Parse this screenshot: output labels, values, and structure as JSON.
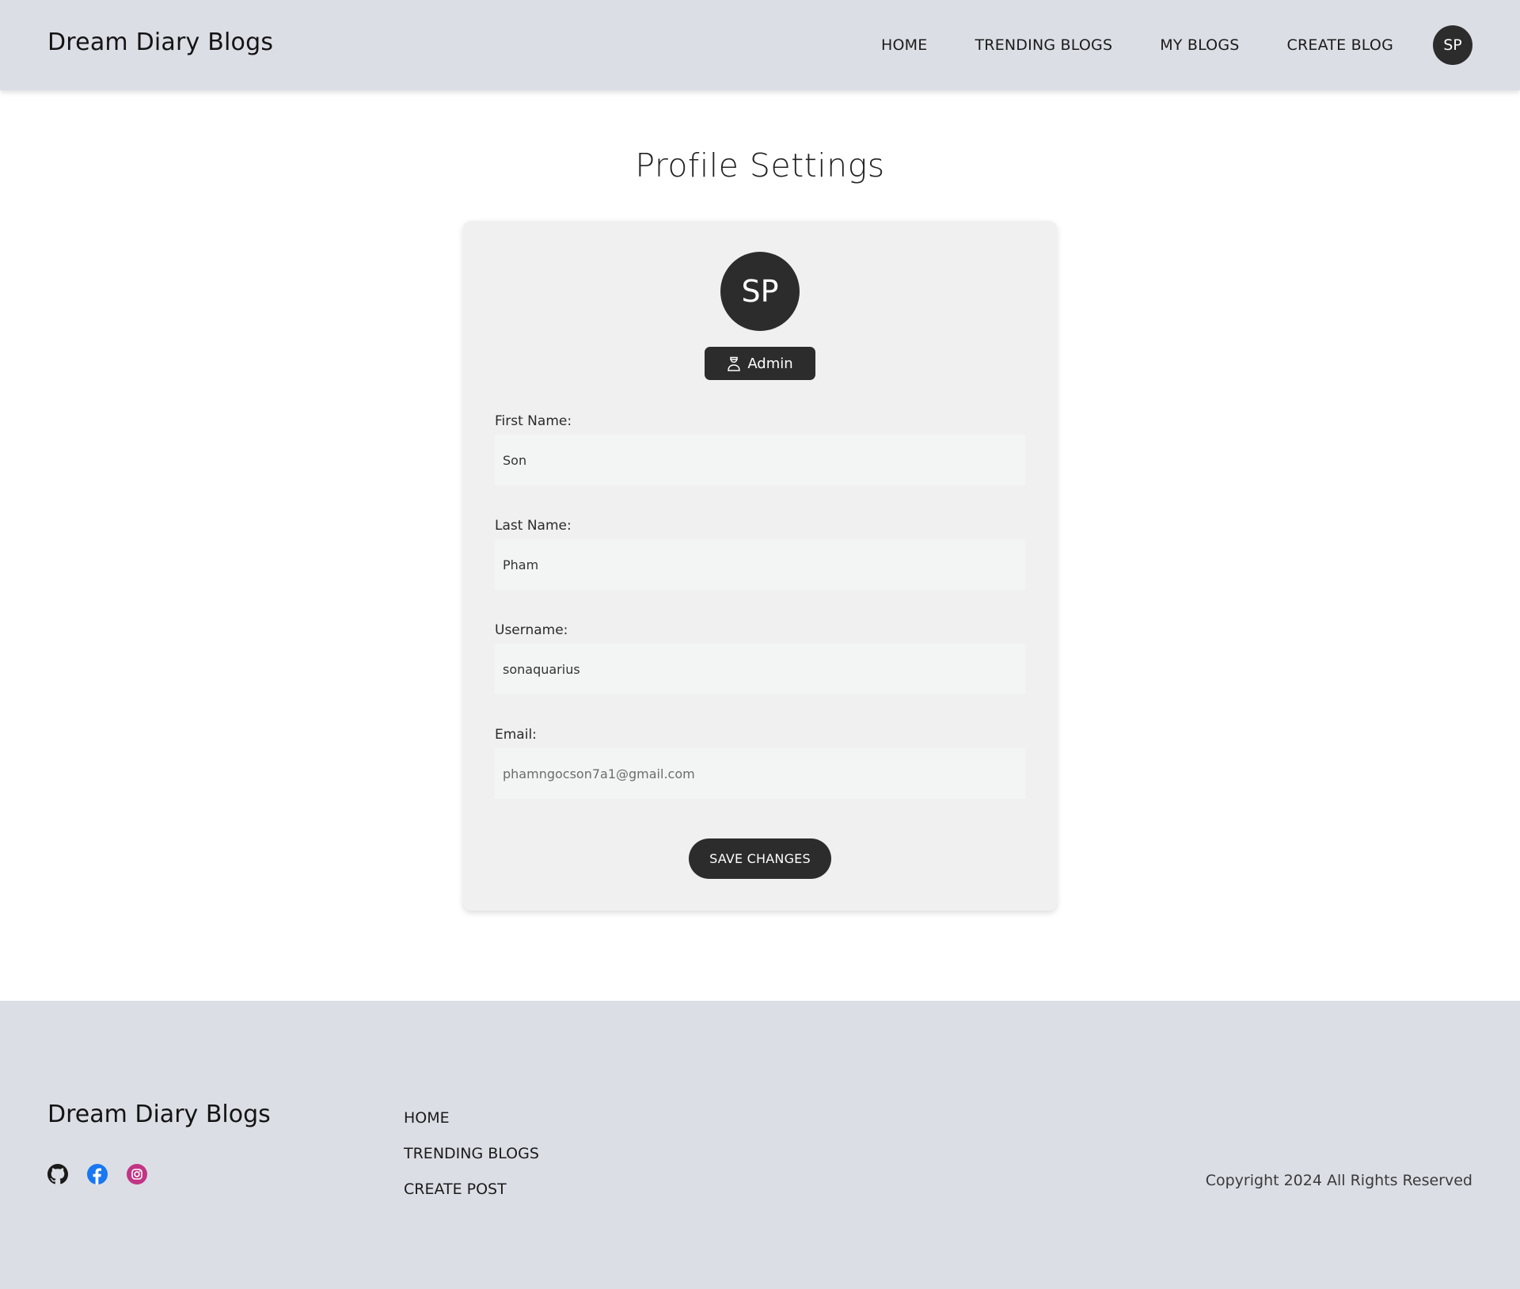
{
  "header": {
    "brand": "Dream Diary Blogs",
    "nav": [
      "HOME",
      "TRENDING BLOGS",
      "MY BLOGS",
      "CREATE BLOG"
    ],
    "avatar_initials": "SP"
  },
  "main": {
    "title": "Profile Settings",
    "avatar_initials": "SP",
    "role": "Admin",
    "role_icon": "admin-user-icon",
    "fields": [
      {
        "label": "First Name:",
        "value": "Son"
      },
      {
        "label": "Last Name:",
        "value": "Pham"
      },
      {
        "label": "Username:",
        "value": "sonaquarius"
      },
      {
        "label": "Email:",
        "value": "phamngocson7a1@gmail.com"
      }
    ],
    "save_label": "SAVE CHANGES"
  },
  "footer": {
    "brand": "Dream Diary Blogs",
    "socials": [
      "github-icon",
      "facebook-icon",
      "instagram-icon"
    ],
    "links": [
      "HOME",
      "TRENDING BLOGS",
      "CREATE POST"
    ],
    "copyright": "Copyright 2024 All Rights Reserved"
  },
  "colors": {
    "header_bg": "#dcdee5",
    "card_bg": "#f0f0f0",
    "dark": "#2c2c2c",
    "facebook": "#1877f2",
    "instagram": "#c13584"
  }
}
